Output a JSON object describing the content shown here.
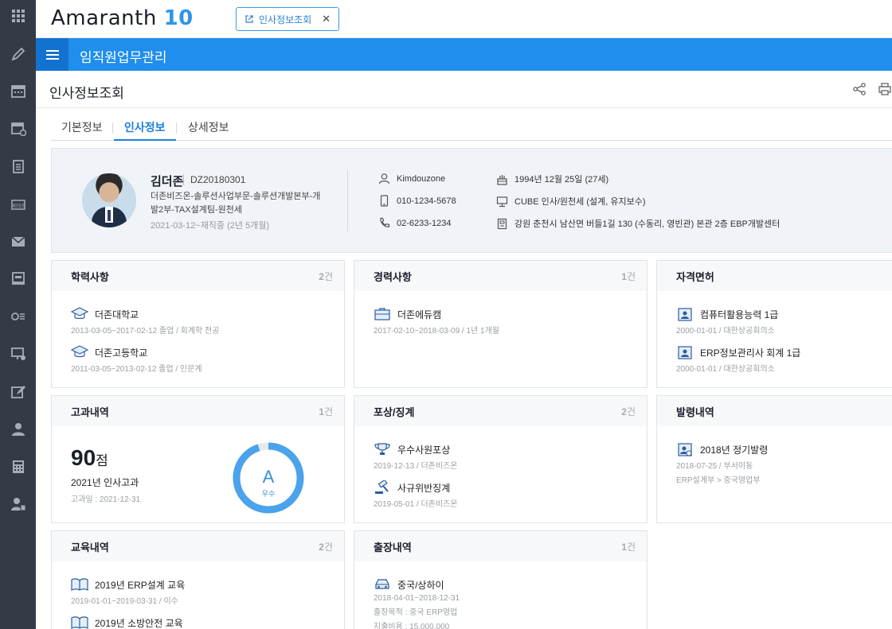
{
  "app": {
    "brand": "Amaranth",
    "brand_version": "10"
  },
  "open_tab": {
    "label": "인사정보조회",
    "close": "✕"
  },
  "menubar": {
    "title": "임직원업무관리"
  },
  "page": {
    "title": "인사정보조회"
  },
  "subtabs": [
    "기본정보",
    "인사정보",
    "상세정보"
  ],
  "profile": {
    "name": "김더존",
    "emp_id": "DZ20180301",
    "dept": "더존비즈온-솔루션사업부문-솔루션개발본부-개발2부-TAX설계팀-원천세",
    "tenure": "2021-03-12~재직중 (2년 5개월)",
    "user_id": "Kimdouzone",
    "mobile": "010-1234-5678",
    "phone": "02-6233-1234",
    "birthday": "1994년 12월 25일 (27세)",
    "duty": "CUBE 인사/원천세 (설계, 유지보수)",
    "address": "강원 춘천시 남산면 버들1길 130 (수동리, 영빈관) 본관 2층 EBP개발센터"
  },
  "cards": {
    "education": {
      "title": "학력사항",
      "count": "2",
      "unit": "건",
      "items": [
        {
          "name": "더존대학교",
          "meta": "2013-03-05~2017-02-12 졸업 / 회계학 전공"
        },
        {
          "name": "더존고등학교",
          "meta": "2011-03-05~2013-02-12 졸업 / 인문계"
        }
      ]
    },
    "career": {
      "title": "경력사항",
      "count": "1",
      "unit": "건",
      "items": [
        {
          "name": "더존에듀캠",
          "meta": "2017-02-10~2018-03-09 / 1년 1개월"
        }
      ]
    },
    "license": {
      "title": "자격면허",
      "items": [
        {
          "name": "컴퓨터활용능력 1급",
          "meta": "2000-01-01 / 대한상공회의소"
        },
        {
          "name": "ERP정보관리사 회계 1급",
          "meta": "2000-01-01 / 대한상공회의소"
        }
      ]
    },
    "evaluation": {
      "title": "고과내역",
      "count": "1",
      "unit": "건",
      "score": "90",
      "score_unit": "점",
      "year_label": "2021년 인사고과",
      "date": "고과일 : 2021-12-31",
      "grade": "A",
      "grade_label": "우수",
      "grade_fraction": 0.95
    },
    "reward": {
      "title": "포상/징계",
      "count": "2",
      "unit": "건",
      "items": [
        {
          "name": "우수사원포상",
          "meta": "2019-12-13 / 더존비즈온"
        },
        {
          "name": "사규위반징계",
          "meta": "2019-05-01 / 더존비즈온"
        }
      ]
    },
    "appointment": {
      "title": "발령내역",
      "items": [
        {
          "name": "2018년 정기발령",
          "meta": "2018-07-25 / 부서이동",
          "meta2": "ERP설계부 > 중국영업부"
        }
      ]
    },
    "training": {
      "title": "교육내역",
      "count": "2",
      "unit": "건",
      "items": [
        {
          "name": "2019년 ERP설계 교육",
          "meta": "2019-01-01~2019-03-31 / 이수"
        },
        {
          "name": "2019년 소방안전 교육"
        }
      ]
    },
    "trip": {
      "title": "출장내역",
      "count": "1",
      "unit": "건",
      "items": [
        {
          "name": "중국/상하이",
          "meta": "2018-04-01~2018-12-31",
          "meta2": "출장목적 : 중국 ERP영업",
          "meta3": "지출비용 : 15,000,000"
        }
      ]
    }
  },
  "colors": {
    "rail": "#343b46",
    "menubar": "#1f8eed",
    "hamburger": "#1173cf",
    "accent": "#1a7fde",
    "donut": "#4aa3ec"
  }
}
